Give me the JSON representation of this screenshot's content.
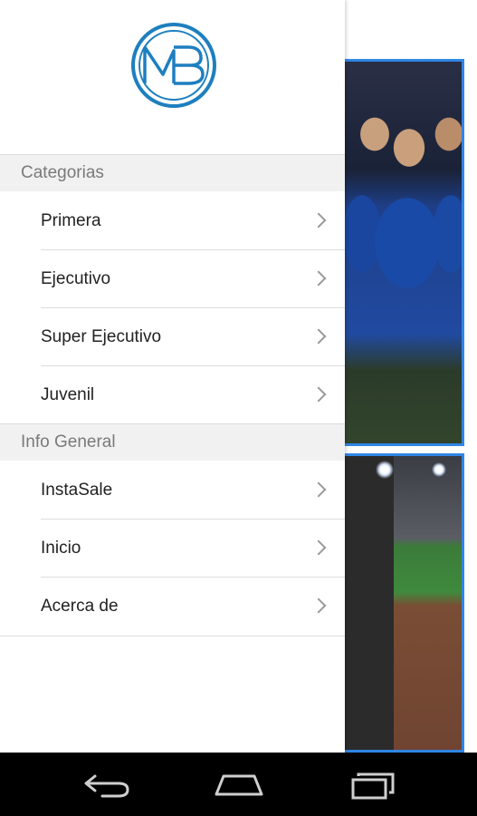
{
  "brand": {
    "logo_text": "MB",
    "accent": "#1e7fbf"
  },
  "drawer": {
    "sections": [
      {
        "title": "Categorias",
        "items": [
          {
            "label": "Primera"
          },
          {
            "label": "Ejecutivo"
          },
          {
            "label": "Super Ejecutivo"
          },
          {
            "label": "Juvenil"
          }
        ]
      },
      {
        "title": "Info General",
        "items": [
          {
            "label": "InstaSale"
          },
          {
            "label": "Inicio"
          },
          {
            "label": "Acerca de"
          }
        ]
      }
    ]
  },
  "content": {
    "photo_border_color": "#2f86e6"
  },
  "navbar": {
    "buttons": [
      "back-icon",
      "home-icon",
      "recent-apps-icon"
    ]
  }
}
